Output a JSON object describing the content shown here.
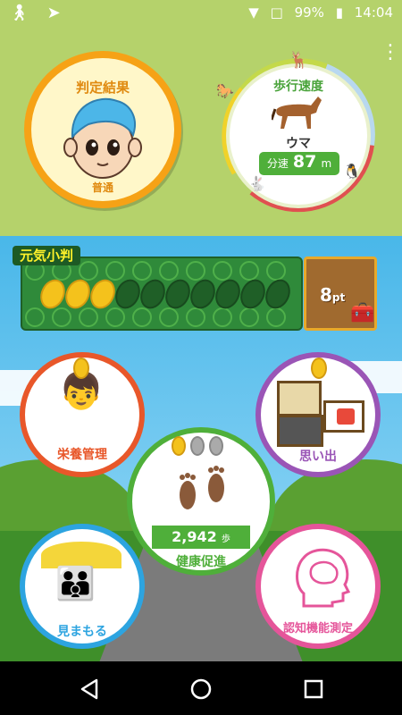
{
  "status_bar": {
    "battery": "99%",
    "time": "14:04"
  },
  "judgement": {
    "title": "判定結果",
    "result": "普通"
  },
  "walking_speed": {
    "title": "歩行速度",
    "animal": "ウマ",
    "prefix": "分速",
    "value": "87",
    "unit": "m"
  },
  "genki_koban": {
    "label": "元気小判",
    "filled_coins": 3,
    "total_coins": 10,
    "points_value": "8",
    "points_unit": "pt"
  },
  "menu": {
    "nutrition": "栄養管理",
    "memories": "思い出",
    "health": "健康促進",
    "steps_value": "2,942",
    "steps_unit": "歩",
    "watch": "見まもる",
    "cognitive": "認知機能測定"
  },
  "colors": {
    "top_bg": "#b5d26b",
    "judge_ring": "#f6a216",
    "nutrition_ring": "#e8572a",
    "memories_ring": "#9a55b6",
    "health_ring": "#4faf3a",
    "watch_ring": "#2da4e0",
    "cognitive_ring": "#e5559a"
  }
}
